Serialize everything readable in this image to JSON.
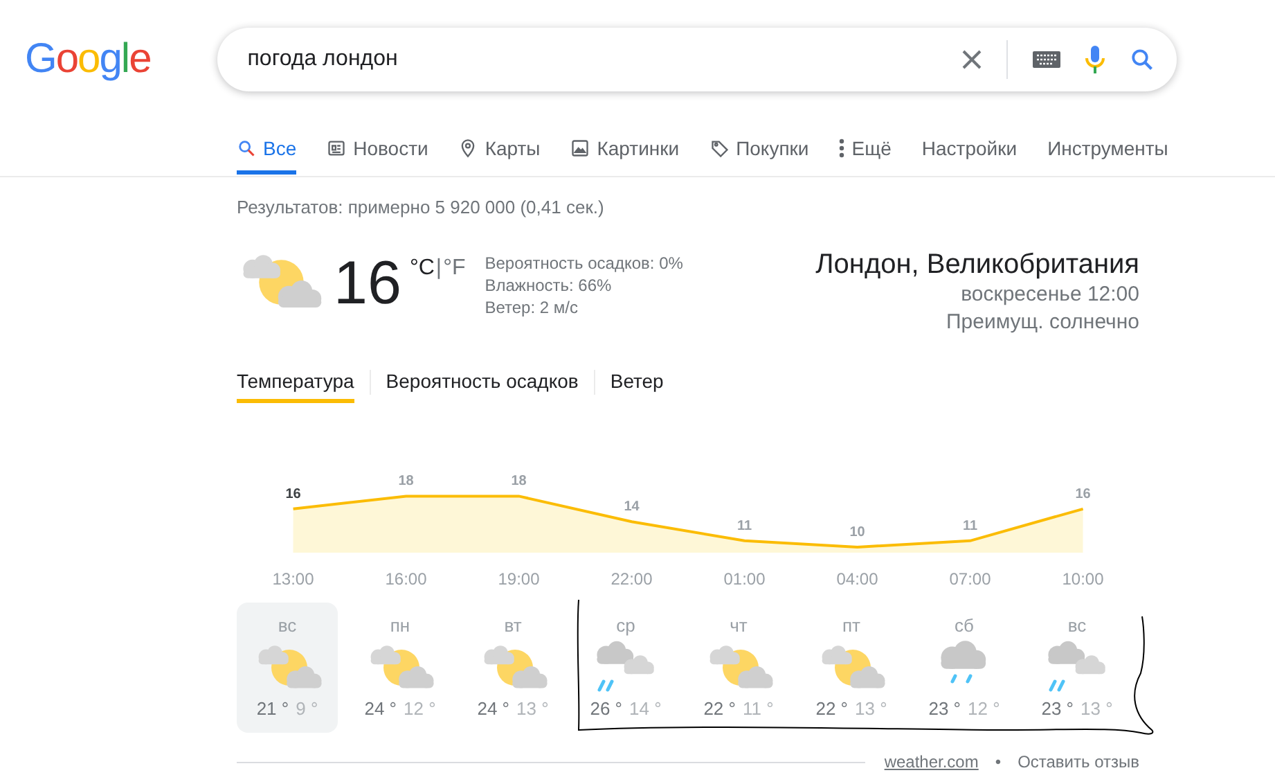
{
  "logo": "Google",
  "search": {
    "value": "погода лондон"
  },
  "tabs": [
    {
      "label": "Все",
      "selected": true
    },
    {
      "label": "Новости",
      "selected": false
    },
    {
      "label": "Карты",
      "selected": false
    },
    {
      "label": "Картинки",
      "selected": false
    },
    {
      "label": "Покупки",
      "selected": false
    },
    {
      "label": "Ещё",
      "selected": false
    }
  ],
  "tools": [
    "Настройки",
    "Инструменты"
  ],
  "result_stats": "Результатов: примерно 5 920 000 (0,41 сек.)",
  "weather": {
    "kind": "partly_cloudy",
    "temperature": "16",
    "unit_c": "°C",
    "unit_sep": "|",
    "unit_f": "°F",
    "details": [
      "Вероятность осадков: 0%",
      "Влажность: 66%",
      "Ветер: 2 м/с"
    ],
    "location": "Лондон, Великобритания",
    "time": "воскресенье 12:00",
    "condition": "Преимущ. солнечно",
    "modes": [
      {
        "label": "Температура",
        "selected": true
      },
      {
        "label": "Вероятность осадков",
        "selected": false
      },
      {
        "label": "Ветер",
        "selected": false
      }
    ],
    "chart_data": {
      "type": "area",
      "categories": [
        "13:00",
        "16:00",
        "19:00",
        "22:00",
        "01:00",
        "04:00",
        "07:00",
        "10:00"
      ],
      "series": [
        {
          "color": "#fbbc04",
          "values": [
            16,
            18,
            18,
            14,
            11,
            10,
            11,
            16
          ]
        }
      ],
      "data_labels": true
    },
    "days": [
      {
        "day": "вс",
        "kind": "partly_cloudy",
        "high": "21 °",
        "low": "9 °",
        "selected": true
      },
      {
        "day": "пн",
        "kind": "partly_cloudy",
        "high": "24 °",
        "low": "12 °",
        "selected": false
      },
      {
        "day": "вт",
        "kind": "partly_cloudy",
        "high": "24 °",
        "low": "13 °",
        "selected": false
      },
      {
        "day": "ср",
        "kind": "showers",
        "high": "26 °",
        "low": "14 °",
        "selected": false
      },
      {
        "day": "чт",
        "kind": "partly_cloudy",
        "high": "22 °",
        "low": "11 °",
        "selected": false
      },
      {
        "day": "пт",
        "kind": "partly_cloudy",
        "high": "22 °",
        "low": "13 °",
        "selected": false
      },
      {
        "day": "сб",
        "kind": "rain",
        "high": "23 °",
        "low": "12 °",
        "selected": false
      },
      {
        "day": "вс",
        "kind": "showers",
        "high": "23 °",
        "low": "13 °",
        "selected": false
      }
    ],
    "source": "weather.com",
    "separator": "•",
    "feedback": "Оставить отзыв"
  }
}
